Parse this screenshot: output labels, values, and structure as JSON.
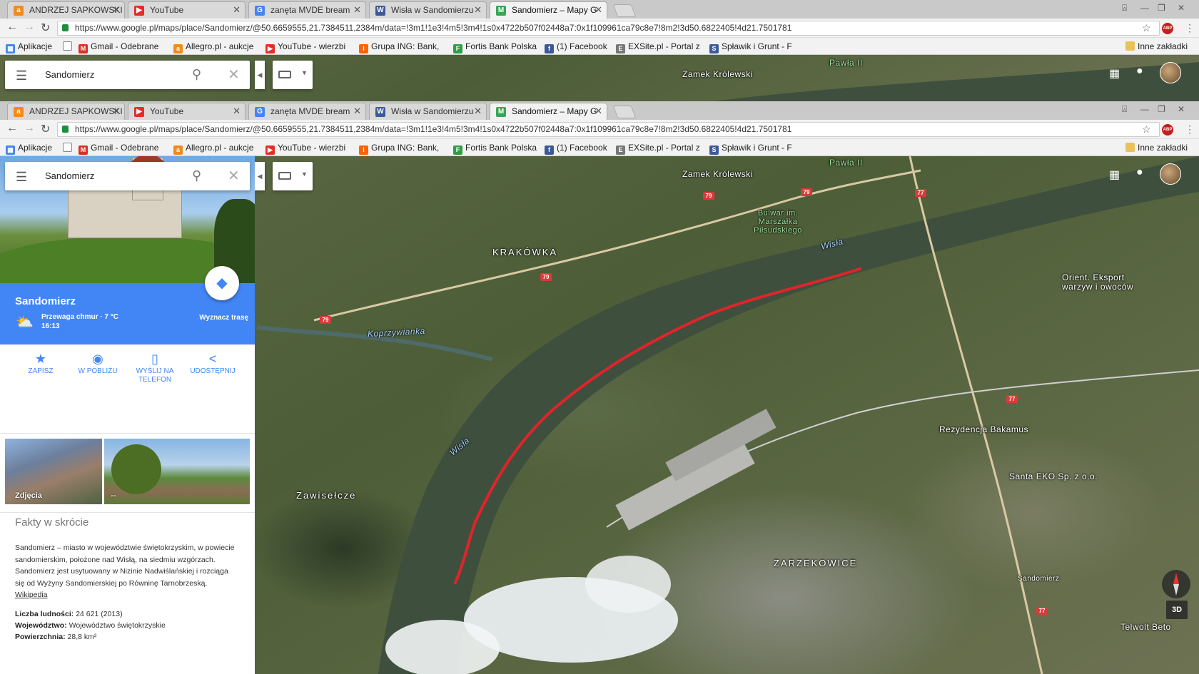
{
  "tabs": [
    {
      "title": "ANDRZEJ SAPKOWSKI",
      "fav_color": "#f28a1c",
      "fav_text": "a"
    },
    {
      "title": "YouTube",
      "fav_color": "#e52d27",
      "fav_text": "▶"
    },
    {
      "title": "zanęta MVDE bream",
      "fav_color": "#4285f4",
      "fav_text": "G"
    },
    {
      "title": "Wisła w Sandomierzu",
      "fav_color": "#3d5a99",
      "fav_text": "W"
    },
    {
      "title": "Sandomierz – Mapy G",
      "fav_color": "#34a853",
      "fav_text": "M"
    }
  ],
  "url": "https://www.google.pl/maps/place/Sandomierz/@50.6659555,21.7384511,2384m/data=!3m1!1e3!4m5!3m4!1s0x4722b507f02448a7:0x1f109961ca79c8e7!8m2!3d50.6822405!4d21.7501781",
  "bookmarks": [
    {
      "label": "Aplikacje",
      "color": "#4285f4",
      "glyph": "▦"
    },
    {
      "label": "",
      "color": "#ffffff",
      "glyph": "□"
    },
    {
      "label": "Gmail - Odebrane",
      "color": "#d93025",
      "glyph": "M"
    },
    {
      "label": "Allegro.pl - aukcje",
      "color": "#f28a1c",
      "glyph": "a"
    },
    {
      "label": "YouTube - wierzbi",
      "color": "#e52d27",
      "glyph": "▶"
    },
    {
      "label": "Grupa ING: Bank,",
      "color": "#ff6200",
      "glyph": "I"
    },
    {
      "label": "Fortis Bank Polska",
      "color": "#2e9e45",
      "glyph": "F"
    },
    {
      "label": "(1) Facebook",
      "color": "#3b5998",
      "glyph": "f"
    },
    {
      "label": "EXSite.pl - Portal z",
      "color": "#777777",
      "glyph": "E"
    },
    {
      "label": "Spławik i Grunt - F",
      "color": "#3d5a99",
      "glyph": "S"
    }
  ],
  "other_bookmarks": "Inne zakładki",
  "search": {
    "query": "Sandomierz"
  },
  "map_labels": {
    "zamek": "Zamek Królewski",
    "pawla": "Pawła II",
    "krakowka": "KRAKÓWKA",
    "bulwar": "Bulwar im. Marszałka Piłsudskiego",
    "wisla1": "Wisła",
    "wisla2": "Wisła",
    "koprzywianka": "Koprzywianka",
    "orient": "Orient. Eksport warzyw i owoców",
    "rezydencja": "Rezydencja Bakamus",
    "santa": "Santa EKO Sp. z o.o.",
    "zawisle": "Zawisełcze",
    "zarzekowice": "ZARZEKOWICE",
    "sandomierz_st": "Sandomierz",
    "telwolt": "Telwolt Beto"
  },
  "road_numbers": {
    "r79a": "79",
    "r79b": "79",
    "r79c": "79",
    "r79d": "79",
    "r77a": "77",
    "r77b": "77",
    "r77c": "77"
  },
  "place": {
    "name": "Sandomierz",
    "weather": "Przewaga chmur · 7 °C",
    "time": "16:13",
    "route": "Wyznacz trasę"
  },
  "actions": [
    {
      "label1": "ZAPISZ",
      "label2": "",
      "icon": "★"
    },
    {
      "label1": "W POBLIŻU",
      "label2": "",
      "icon": "◉"
    },
    {
      "label1": "WYŚLIJ NA",
      "label2": "TELEFON",
      "icon": "▯"
    },
    {
      "label1": "UDOSTĘPNIJ",
      "label2": "",
      "icon": "<"
    }
  ],
  "photos_label": "Zdjęcia",
  "facts": {
    "title": "Fakty w skrócie",
    "body": "Sandomierz – miasto w województwie świętokrzyskim, w powiecie sandomierskim, położone nad Wisłą, na siedmiu wzgórzach. Sandomierz jest usytuowany w Nizinie Nadwiślańskiej i rozciąga się od Wyżyny Sandomierskiej po Równinę Tarnobrzeską.",
    "link": "Wikipedia",
    "population_label": "Liczba ludności:",
    "population": "24 621 (2013)",
    "voivodeship_label": "Województwo:",
    "voivodeship": "Województwo świętokrzyskie",
    "area_label": "Powierzchnia:",
    "area": "28,8 km²"
  },
  "view_3d": "3D",
  "colors": {
    "accent": "#4285f4",
    "route": "#e0242a",
    "river": "#3e4f3e"
  }
}
